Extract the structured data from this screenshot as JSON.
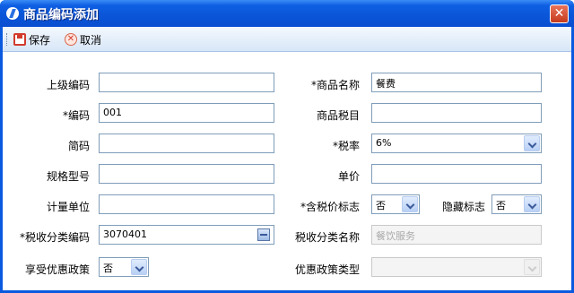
{
  "window": {
    "title": "商品编码添加",
    "close_symbol": "✕"
  },
  "toolbar": {
    "save_label": "保存",
    "cancel_label": "取消",
    "cancel_symbol": "✕"
  },
  "form": {
    "parent_code": {
      "label": "上级编码",
      "value": ""
    },
    "product_name": {
      "label": "*商品名称",
      "value": "餐费"
    },
    "code": {
      "label": "*编码",
      "value": "001"
    },
    "product_tax_item": {
      "label": "商品税目",
      "value": ""
    },
    "short_code": {
      "label": "简码",
      "value": ""
    },
    "tax_rate": {
      "label": "*税率",
      "value": "6%"
    },
    "spec_model": {
      "label": "规格型号",
      "value": ""
    },
    "unit_price": {
      "label": "单价",
      "value": ""
    },
    "unit": {
      "label": "计量单位",
      "value": ""
    },
    "tax_included": {
      "label": "*含税价标志",
      "value": "否"
    },
    "hidden_flag": {
      "label": "隐藏标志",
      "value": "否"
    },
    "tax_class_code": {
      "label": "*税收分类编码",
      "value": "3070401"
    },
    "tax_class_name": {
      "label": "税收分类名称",
      "value": "餐饮服务"
    },
    "preferential": {
      "label": "享受优惠政策",
      "value": "否"
    },
    "preferential_type": {
      "label": "优惠政策类型",
      "value": ""
    }
  },
  "colors": {
    "titlebar": "#0a55d8",
    "toolbar": "#d7e6f7",
    "border": "#7f9db9"
  }
}
